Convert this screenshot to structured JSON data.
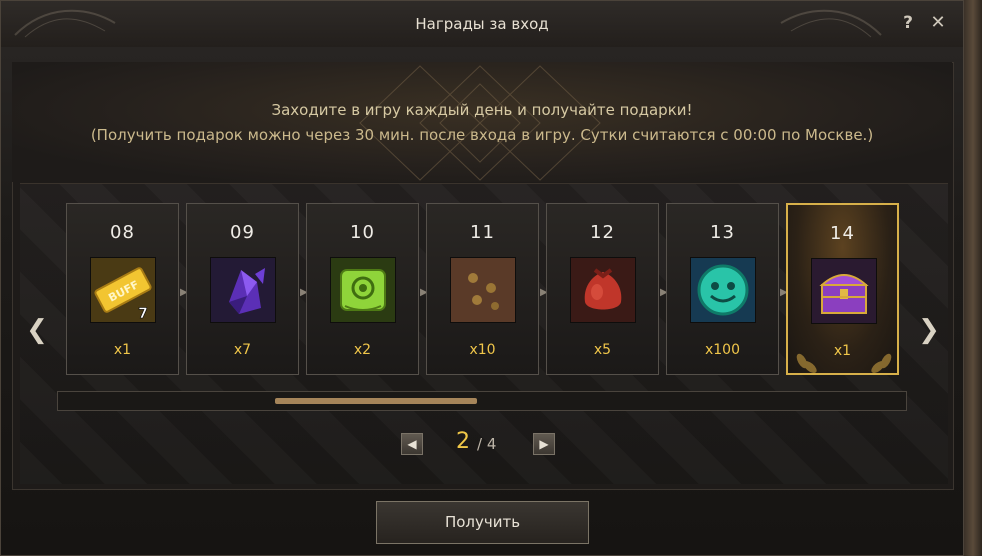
{
  "window": {
    "title": "Награды за вход",
    "help_label": "?",
    "close_label": "✕"
  },
  "message": {
    "line1": "Заходите в игру каждый день и получайте подарки!",
    "line2": "(Получить подарок можно через 30 мин. после входа в игру. Сутки считаются с 00:00 по Москве.)"
  },
  "rewards": [
    {
      "day": "08",
      "qty": "x1",
      "icon": "buff-ticket-icon",
      "badge": "7"
    },
    {
      "day": "09",
      "qty": "x7",
      "icon": "purple-crystal-icon"
    },
    {
      "day": "10",
      "qty": "x2",
      "icon": "green-scroll-icon"
    },
    {
      "day": "11",
      "qty": "x10",
      "icon": "seeds-icon"
    },
    {
      "day": "12",
      "qty": "x5",
      "icon": "red-pouch-icon"
    },
    {
      "day": "13",
      "qty": "x100",
      "icon": "teal-face-coin-icon"
    },
    {
      "day": "14",
      "qty": "x1",
      "icon": "purple-chest-icon",
      "highlighted": true
    }
  ],
  "carousel": {
    "prev_label": "❮",
    "next_label": "❯",
    "scroll_position": 0.3
  },
  "pager": {
    "current": "2",
    "total": "/ 4",
    "prev_label": "◀",
    "next_label": "▶"
  },
  "claim_button": {
    "label": "Получить"
  },
  "colors": {
    "accent_gold": "#f0c64a",
    "highlight_border": "#d7b04a"
  }
}
